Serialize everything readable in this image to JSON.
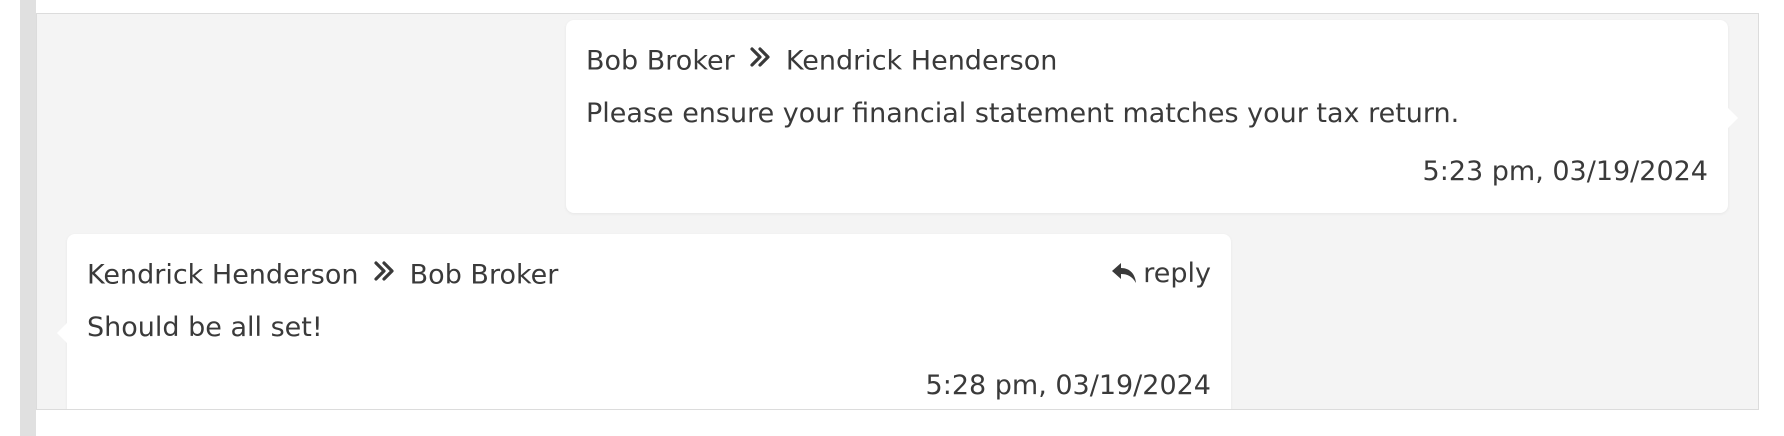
{
  "messages": [
    {
      "from": "Bob Broker",
      "to": "Kendrick Henderson",
      "text": "Please ensure your financial statement matches your tax return.",
      "timestamp": "5:23 pm, 03/19/2024",
      "direction": "sent",
      "icons": {
        "separator": "double-chevron-right-icon"
      }
    },
    {
      "from": "Kendrick Henderson",
      "to": "Bob Broker",
      "text": "Should be all set!",
      "timestamp": "5:28 pm, 03/19/2024",
      "direction": "received",
      "reply_label": "reply",
      "icons": {
        "separator": "double-chevron-right-icon",
        "reply": "reply-arrow-icon"
      }
    }
  ],
  "colors": {
    "panel_background": "#f4f4f4",
    "bubble_background": "#ffffff",
    "text": "#3a3a3a",
    "rail": "#e0e0e0"
  }
}
